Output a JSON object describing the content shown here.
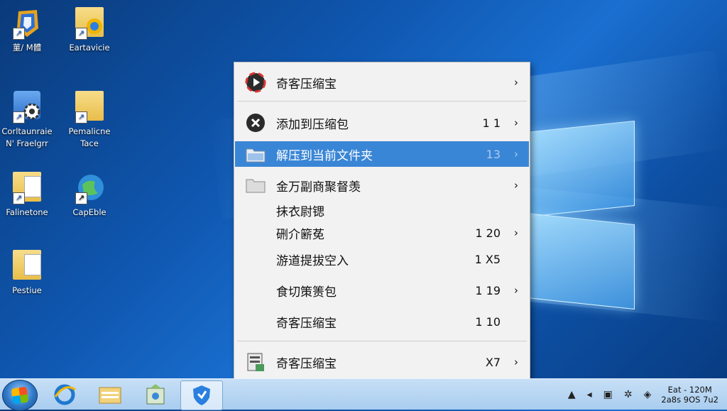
{
  "desktop": {
    "icons": [
      {
        "label": "菫/ M體",
        "icon": "app-shortcut-icon"
      },
      {
        "label": "Eartavicie",
        "icon": "browser-folder-icon"
      },
      {
        "label": "Corltaunraie",
        "label2": "N' Fraelgrr",
        "icon": "settings-shortcut-icon"
      },
      {
        "label": "Pemalicne",
        "label2": "Tace",
        "icon": "folder-shortcut-icon"
      },
      {
        "label": "Falinetone",
        "icon": "document-shortcut-icon"
      },
      {
        "label": "CapEble",
        "icon": "globe-shortcut-icon"
      },
      {
        "label": "Pestiue",
        "icon": "folder-document-icon"
      }
    ]
  },
  "context_menu": {
    "items": [
      {
        "label": "奇客压缩宝",
        "shortcut": "",
        "submenu": "›",
        "icon": "app-logo-icon"
      },
      {
        "label": "添加到压缩包",
        "shortcut": "1 1",
        "submenu": "›",
        "icon": "add-archive-icon"
      },
      {
        "label": "解压到当前文件夹",
        "shortcut": "13",
        "submenu": "›",
        "icon": "extract-folder-icon",
        "highlighted": true
      },
      {
        "label": "金万副商聚督羡",
        "shortcut": "",
        "submenu": "›",
        "icon": "folder-icon"
      },
      {
        "label": "抹衣尉锶",
        "shortcut": "",
        "submenu": ""
      },
      {
        "label": "硎介簖莬",
        "shortcut": "1 20",
        "submenu": "›"
      },
      {
        "label": "游道提拔空入",
        "shortcut": "1 X5",
        "submenu": ""
      },
      {
        "label": "食切策箦包",
        "shortcut": "1 19",
        "submenu": "›"
      },
      {
        "label": "奇客压缩宝",
        "shortcut": "1 10",
        "submenu": ""
      },
      {
        "label": "奇客压缩宝",
        "shortcut": "X7",
        "submenu": "›",
        "icon": "archive-tool-icon"
      }
    ]
  },
  "taskbar": {
    "buttons": [
      "start-button",
      "internet-explorer-icon",
      "file-explorer-icon",
      "app-installer-icon",
      "shield-app-icon"
    ],
    "tray_icons": [
      "show-hidden-icons-icon",
      "speaker-icon",
      "network-icon",
      "action-center-icon",
      "flag-icon"
    ],
    "clock_line1": "Eat - 120M",
    "clock_line2": "2a8s 9OS 7u2"
  },
  "colors": {
    "highlight": "#3a86d6",
    "menu_bg": "#f2f2f2",
    "desktop": "#0f57b0"
  }
}
